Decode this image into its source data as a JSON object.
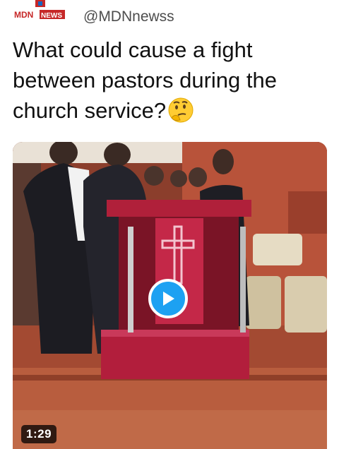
{
  "tweet": {
    "avatar_logo_text": "MDNnews",
    "handle": "@MDNnewss",
    "text": "What could cause a fight between pastors during the church service?",
    "emoji": "thinking-face-icon"
  },
  "video": {
    "duration": "1:29",
    "play_icon": "play-icon",
    "colors": {
      "accent": "#1da1f2",
      "podium": "#b0203a"
    }
  }
}
